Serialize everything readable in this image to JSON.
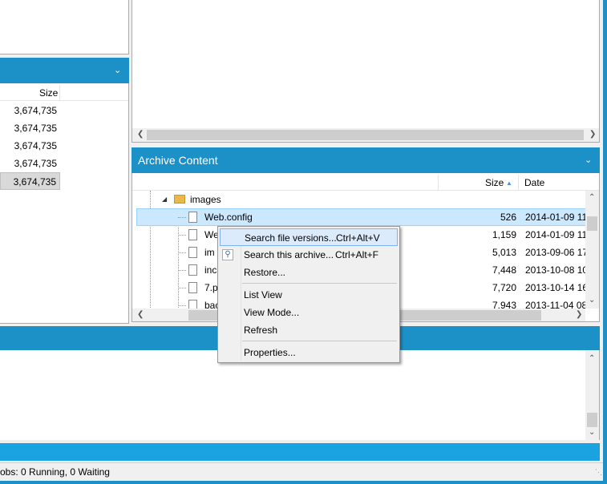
{
  "left_list": {
    "size_header": "Size",
    "sizes": [
      "3,674,735",
      "3,674,735",
      "3,674,735",
      "3,674,735",
      "3,674,735"
    ]
  },
  "archive": {
    "title": "Archive Content",
    "col_size": "Size",
    "col_date": "Date",
    "folder": "images",
    "rows": [
      {
        "name": "Web.config",
        "size": "526",
        "date": "2014-01-09 11:"
      },
      {
        "name": "We",
        "size": "1,159",
        "date": "2014-01-09 11:"
      },
      {
        "name": "im",
        "size": "5,013",
        "date": "2013-09-06 17:"
      },
      {
        "name": "inc",
        "size": "7,448",
        "date": "2013-10-08 10:"
      },
      {
        "name": "7.p",
        "size": "7,720",
        "date": "2013-10-14 16:"
      },
      {
        "name": "bac",
        "size": "7,943",
        "date": "2013-11-04 08:"
      }
    ]
  },
  "context_menu": {
    "search_versions": "Search file versions...",
    "search_versions_shortcut": "Ctrl+Alt+V",
    "search_archive": "Search this archive...",
    "search_archive_shortcut": "Ctrl+Alt+F",
    "restore": "Restore...",
    "list_view": "List View",
    "view_mode": "View Mode...",
    "refresh": "Refresh",
    "properties": "Properties..."
  },
  "status_bar": {
    "jobs": "obs: 0 Running, 0 Waiting"
  },
  "colors": {
    "accent": "#1c91c8",
    "selection": "#cce8ff"
  }
}
